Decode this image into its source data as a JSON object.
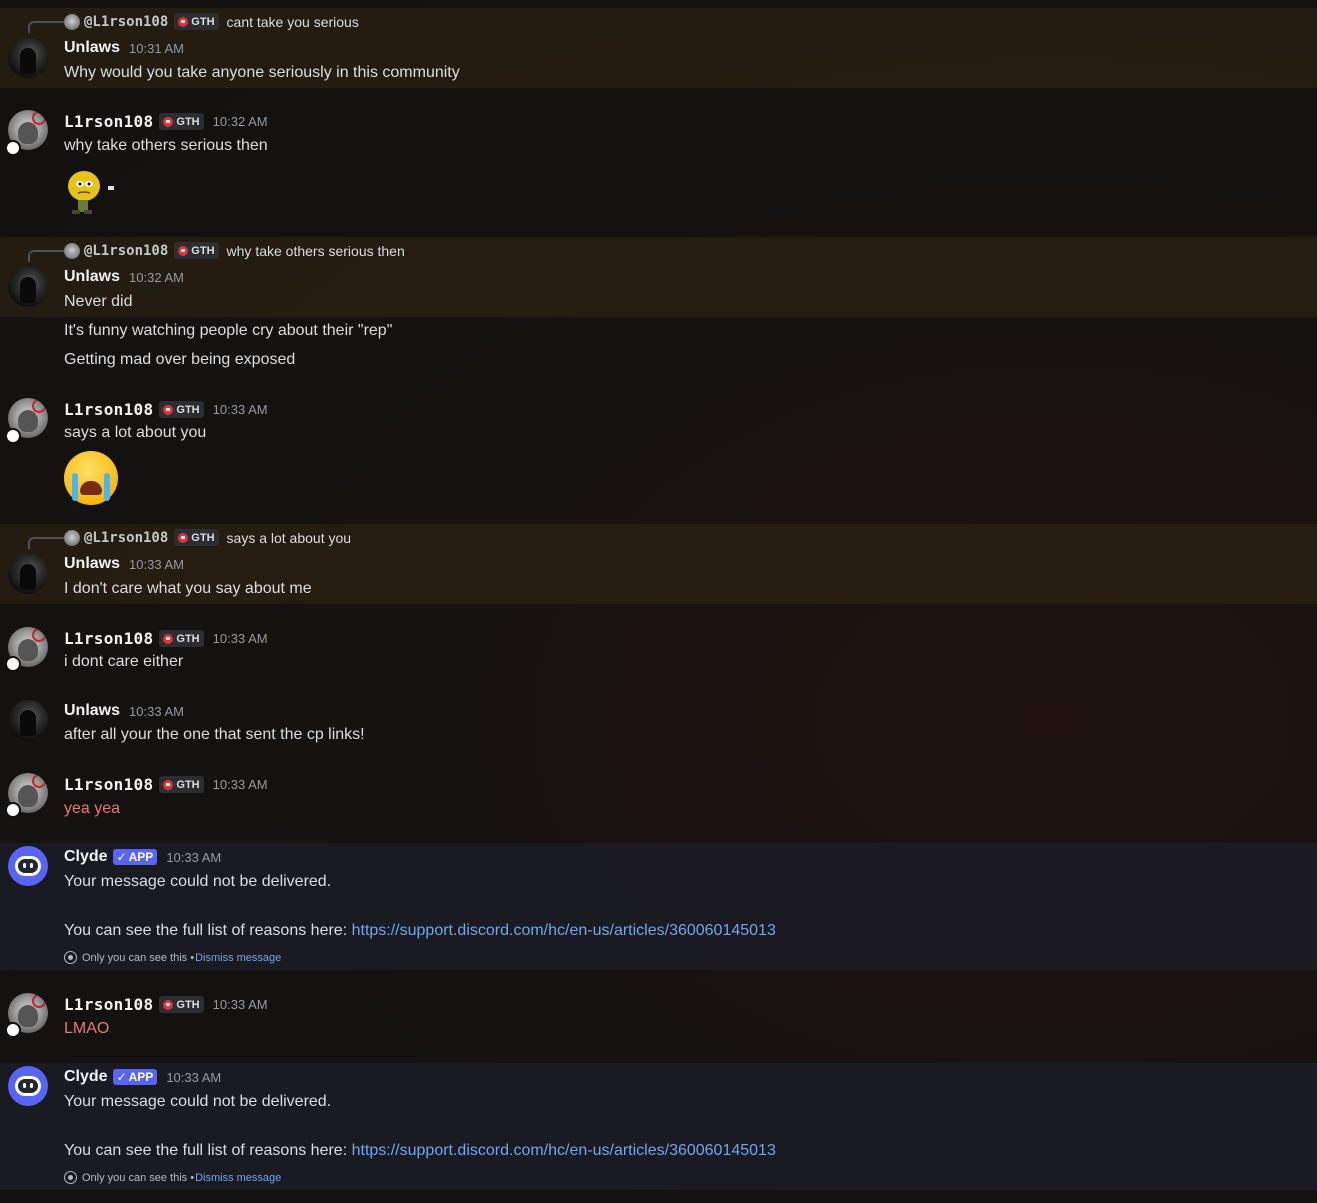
{
  "users": {
    "unlaws": "Unlaws",
    "l1rson": "L1rson108",
    "l1rson_mention": "@L1rson108",
    "clyde": "Clyde"
  },
  "tags": {
    "gth": "GTH",
    "app": "APP"
  },
  "messages": [
    {
      "reply": {
        "mention": "@L1rson108",
        "tag": "GTH",
        "text": "cant take you serious"
      },
      "author": "Unlaws",
      "time": "10:31 AM",
      "lines": [
        "Why would you take anyone seriously in this community"
      ]
    },
    {
      "author": "L1rson108",
      "tag": "GTH",
      "time": "10:32 AM",
      "lines": [
        "why take others serious then"
      ],
      "sticker": "thinking-emoji-sticker"
    },
    {
      "reply": {
        "mention": "@L1rson108",
        "tag": "GTH",
        "text": "why take others serious then"
      },
      "author": "Unlaws",
      "time": "10:32 AM",
      "lines": [
        "Never did",
        "It's funny watching people cry about their \"rep\"",
        "Getting mad over being exposed"
      ]
    },
    {
      "author": "L1rson108",
      "tag": "GTH",
      "time": "10:33 AM",
      "lines": [
        "says a lot about you"
      ],
      "emoji": "loudly-crying-face"
    },
    {
      "reply": {
        "mention": "@L1rson108",
        "tag": "GTH",
        "text": "says a lot about you"
      },
      "author": "Unlaws",
      "time": "10:33 AM",
      "lines": [
        "I don't care what you say about me"
      ]
    },
    {
      "author": "L1rson108",
      "tag": "GTH",
      "time": "10:33 AM",
      "lines": [
        "i dont care either"
      ]
    },
    {
      "author": "Unlaws",
      "time": "10:33 AM",
      "lines": [
        "after all your the one that sent the cp links!"
      ]
    },
    {
      "author": "L1rson108",
      "tag": "GTH",
      "time": "10:33 AM",
      "lines": [
        "yea yea"
      ],
      "failed": true
    },
    {
      "author": "Clyde",
      "tag": "APP",
      "time": "10:33 AM",
      "lines": [
        "Your message could not be delivered.",
        "You can see the full list of reasons here: "
      ],
      "link": "https://support.discord.com/hc/en-us/articles/360060145013",
      "ephemeral": "Only you can see this •",
      "dismiss": "Dismiss message"
    },
    {
      "author": "L1rson108",
      "tag": "GTH",
      "time": "10:33 AM",
      "lines": [
        "LMAO"
      ],
      "failed": true
    },
    {
      "author": "Clyde",
      "tag": "APP",
      "time": "10:33 AM",
      "lines": [
        "Your message could not be delivered.",
        "You can see the full list of reasons here: "
      ],
      "link": "https://support.discord.com/hc/en-us/articles/360060145013",
      "ephemeral": "Only you can see this •",
      "dismiss": "Dismiss message"
    }
  ],
  "colors": {
    "highlight": "#322610",
    "failed_text": "#e87a6f",
    "link": "#6ea7f0",
    "app_badge": "#5865f2"
  }
}
